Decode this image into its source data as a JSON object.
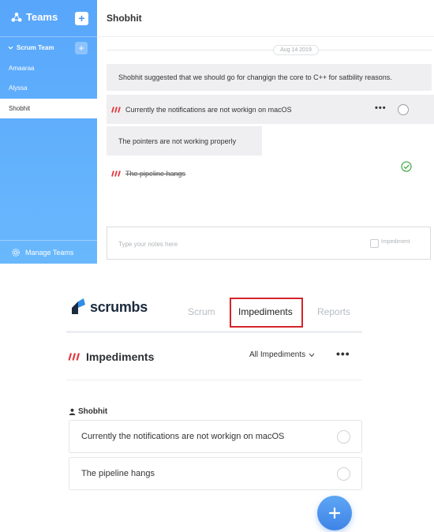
{
  "teams_app": {
    "sidebar": {
      "title": "Teams",
      "add_team_label": "+",
      "group": {
        "name": "Scrum Team",
        "add_label": "+",
        "members": [
          "Amaaraa",
          "Alyssa",
          "Shobhit"
        ],
        "active_member": "Shobhit"
      },
      "manage_label": "Manage Teams"
    },
    "main": {
      "header": "Shobhit",
      "date": "Aug 14 2019",
      "entries": {
        "note1": "Shobhit suggested that we should go for changign the core to C++ for satbility reasons.",
        "imp1": "Currently the notifications are not workign on macOS",
        "note2": "The pointers are not working properly",
        "imp2": "The pipeline hangs"
      },
      "more_label": "•••",
      "notes_input": {
        "value": "",
        "placeholder": "Type your notes here"
      },
      "impediment_checkbox_label": "Impediment"
    }
  },
  "scrumbs": {
    "logo_text": "scrumbs",
    "tabs": [
      "Scrum",
      "Impediments",
      "Reports"
    ],
    "active_tab": "Impediments",
    "page_title": "Impediments",
    "filter_label": "All Impediments",
    "more_label": "•••",
    "person": "Shobhit",
    "impediments": [
      "Currently the notifications are not workign on macOS",
      "The pipeline hangs"
    ],
    "fab_label": "+"
  },
  "colors": {
    "sidebar_blue": "#58a6fb",
    "impediment_red": "#e0393e",
    "highlight_red": "#d6232a",
    "check_green": "#4caf50",
    "fab_blue": "#4a8fea",
    "logo_blue": "#2e8fe8"
  },
  "icons": {
    "brand": "teams-icon",
    "chevron": "chevron-down-icon",
    "manage": "gear-icon",
    "impediment": "impediment-slashes-icon",
    "done": "check-circle-icon",
    "person": "person-icon",
    "fab": "plus-icon"
  }
}
